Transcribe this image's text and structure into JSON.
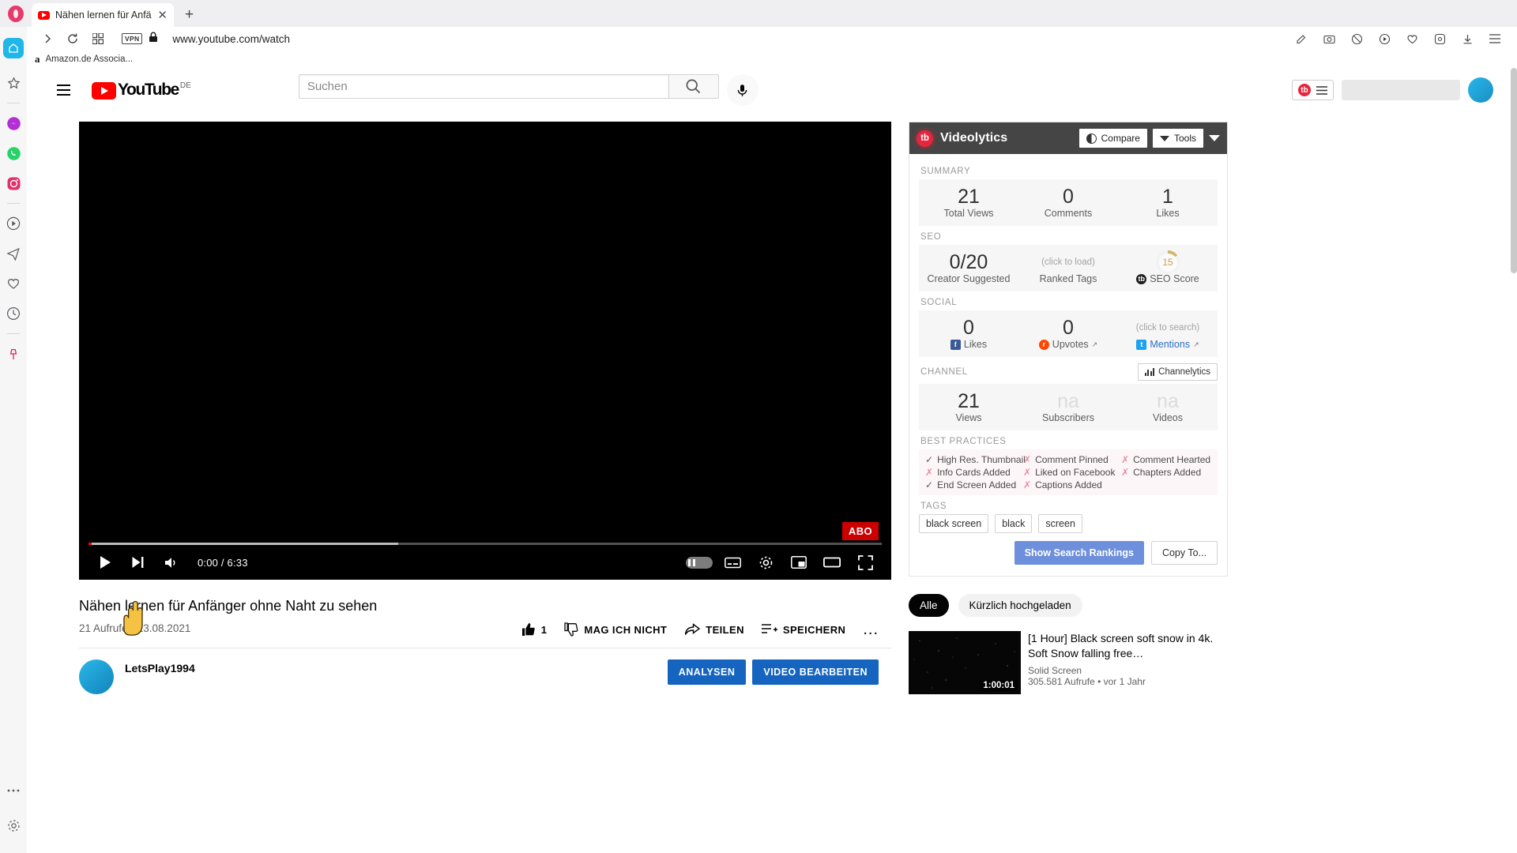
{
  "browser": {
    "tab_title": "Nähen lernen für Anfänger",
    "url": "www.youtube.com/watch",
    "vpn_label": "VPN",
    "bookmark": "Amazon.de Associa..."
  },
  "youtube": {
    "logo_text": "YouTube",
    "country_code": "DE",
    "search_placeholder": "Suchen",
    "video": {
      "title": "Nähen lernen für Anfänger ohne Naht zu sehen",
      "meta": "21 Aufrufe • 13.08.2021",
      "current_time": "0:00",
      "duration": "6:33",
      "time_display": "0:00 / 6:33",
      "abo_badge": "ABO",
      "like_count": "1",
      "dislike_label": "MAG ICH NICHT",
      "share_label": "TEILEN",
      "save_label": "SPEICHERN",
      "more_label": "..."
    },
    "owner": {
      "name": "LetsPlay1994",
      "analytics_button": "ANALYSEN",
      "edit_button": "VIDEO BEARBEITEN"
    },
    "chips": [
      {
        "label": "Alle",
        "active": true
      },
      {
        "label": "Kürzlich hochgeladen",
        "active": false
      }
    ],
    "related": [
      {
        "title": "[1 Hour] Black screen soft snow in 4k. Soft Snow falling free…",
        "channel": "Solid Screen",
        "meta": "305.581 Aufrufe • vor 1 Jahr",
        "duration": "1:00:01"
      }
    ]
  },
  "videolytics": {
    "title": "Videolytics",
    "logo_text": "tb",
    "compare_label": "Compare",
    "tools_label": "Tools",
    "sections": {
      "summary": {
        "label": "SUMMARY",
        "stats": [
          {
            "value": "21",
            "label": "Total Views"
          },
          {
            "value": "0",
            "label": "Comments"
          },
          {
            "value": "1",
            "label": "Likes"
          }
        ]
      },
      "seo": {
        "label": "SEO",
        "creator_suggested_value": "0/20",
        "creator_suggested_label": "Creator Suggested",
        "ranked_tags_value": "(click to load)",
        "ranked_tags_label": "Ranked Tags",
        "seo_score_value": "15",
        "seo_score_label": "SEO Score"
      },
      "social": {
        "label": "SOCIAL",
        "facebook_value": "0",
        "facebook_label": "Likes",
        "reddit_value": "0",
        "reddit_label": "Upvotes",
        "twitter_value": "(click to search)",
        "twitter_label": "Mentions"
      },
      "channel": {
        "label": "CHANNEL",
        "channelytics_label": "Channelytics",
        "stats": [
          {
            "value": "21",
            "label": "Views",
            "na": false
          },
          {
            "value": "na",
            "label": "Subscribers",
            "na": true
          },
          {
            "value": "na",
            "label": "Videos",
            "na": true
          }
        ]
      },
      "best_practices": {
        "label": "BEST PRACTICES",
        "items": [
          {
            "label": "High Res. Thumbnail",
            "ok": true
          },
          {
            "label": "Comment Pinned",
            "ok": false
          },
          {
            "label": "Comment Hearted",
            "ok": false
          },
          {
            "label": "Info Cards Added",
            "ok": false
          },
          {
            "label": "Liked on Facebook",
            "ok": false
          },
          {
            "label": "Chapters Added",
            "ok": false
          },
          {
            "label": "End Screen Added",
            "ok": true
          },
          {
            "label": "Captions Added",
            "ok": false
          }
        ]
      },
      "tags": {
        "label": "TAGS",
        "items": [
          "black screen",
          "black",
          "screen"
        ],
        "show_rankings_label": "Show Search Rankings",
        "copy_to_label": "Copy To..."
      }
    }
  },
  "colors": {
    "youtube_red": "#ff0000",
    "videolytics_red": "#e8243c",
    "panel_header": "#454545",
    "primary_blue": "#1565c0",
    "rankings_blue": "#6d8fdc"
  }
}
